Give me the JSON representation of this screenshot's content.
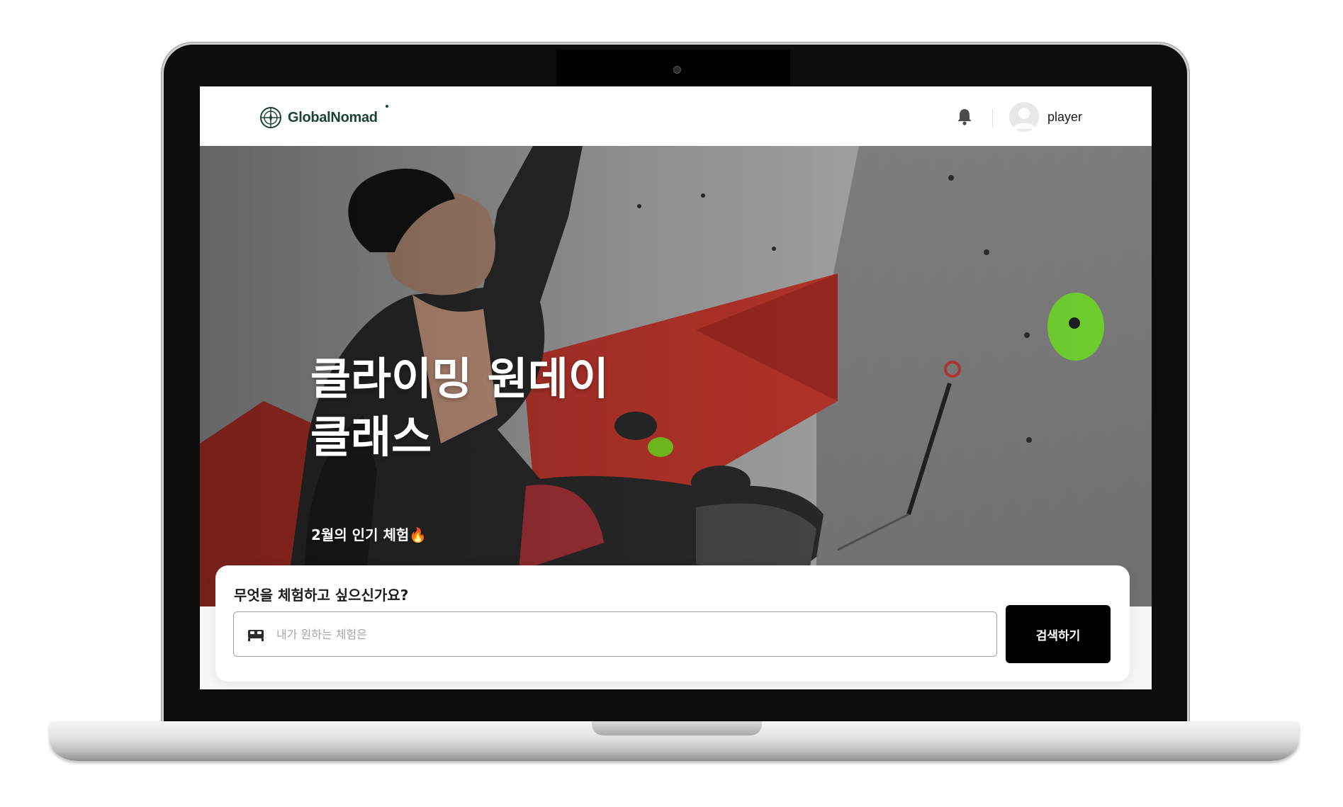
{
  "header": {
    "logo_text": "GlobalNomad",
    "username": "player"
  },
  "hero": {
    "title": "클라이밍 원데이\n클래스",
    "subtitle": "2월의 인기 체험🔥"
  },
  "search": {
    "heading": "무엇을 체험하고 싶으신가요?",
    "placeholder": "내가 원하는 체험은",
    "value": "",
    "button_label": "검색하기"
  },
  "icons": {
    "logo": "globe-compass-icon",
    "notification": "bell-icon",
    "profile": "avatar-icon",
    "search_field": "bed-icon"
  },
  "colors": {
    "brand": "#1b4332",
    "button": "#000000",
    "hero_wall_red": "#c9302c",
    "hold_green": "#7ed321"
  }
}
